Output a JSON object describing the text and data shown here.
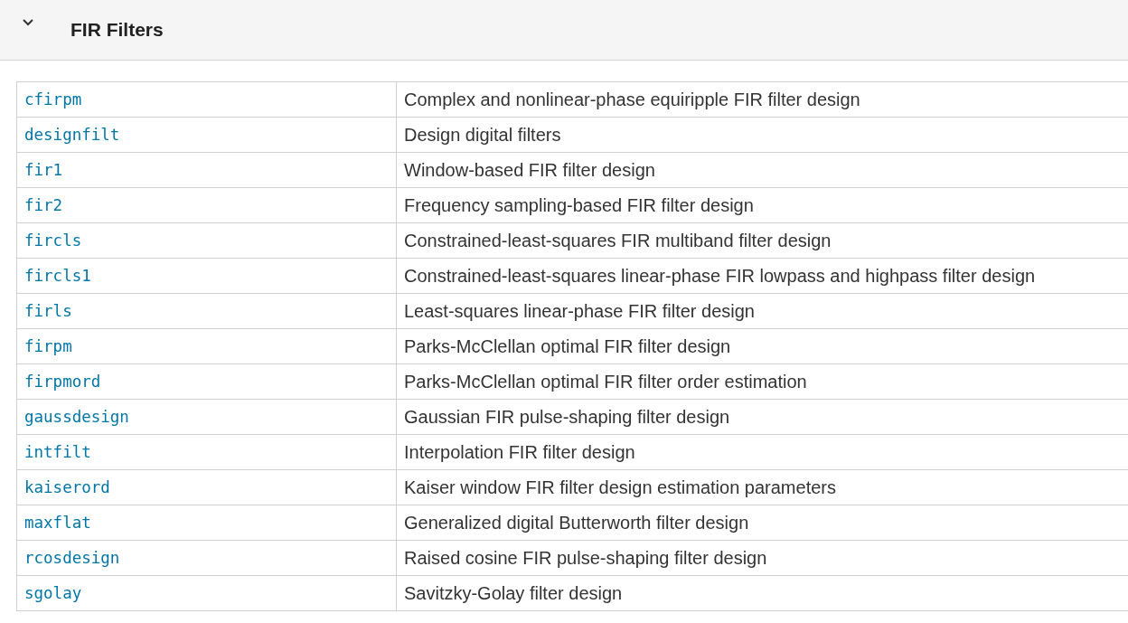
{
  "section": {
    "title": "FIR Filters",
    "expanded": true
  },
  "table": {
    "rows": [
      {
        "function": "cfirpm",
        "description": "Complex and nonlinear-phase equiripple FIR filter design"
      },
      {
        "function": "designfilt",
        "description": "Design digital filters"
      },
      {
        "function": "fir1",
        "description": "Window-based FIR filter design"
      },
      {
        "function": "fir2",
        "description": "Frequency sampling-based FIR filter design"
      },
      {
        "function": "fircls",
        "description": "Constrained-least-squares FIR multiband filter design"
      },
      {
        "function": "fircls1",
        "description": "Constrained-least-squares linear-phase FIR lowpass and highpass filter design"
      },
      {
        "function": "firls",
        "description": "Least-squares linear-phase FIR filter design"
      },
      {
        "function": "firpm",
        "description": "Parks-McClellan optimal FIR filter design"
      },
      {
        "function": "firpmord",
        "description": "Parks-McClellan optimal FIR filter order estimation"
      },
      {
        "function": "gaussdesign",
        "description": "Gaussian FIR pulse-shaping filter design"
      },
      {
        "function": "intfilt",
        "description": "Interpolation FIR filter design"
      },
      {
        "function": "kaiserord",
        "description": "Kaiser window FIR filter design estimation parameters"
      },
      {
        "function": "maxflat",
        "description": "Generalized digital Butterworth filter design"
      },
      {
        "function": "rcosdesign",
        "description": "Raised cosine FIR pulse-shaping filter design"
      },
      {
        "function": "sgolay",
        "description": "Savitzky-Golay filter design"
      }
    ]
  }
}
